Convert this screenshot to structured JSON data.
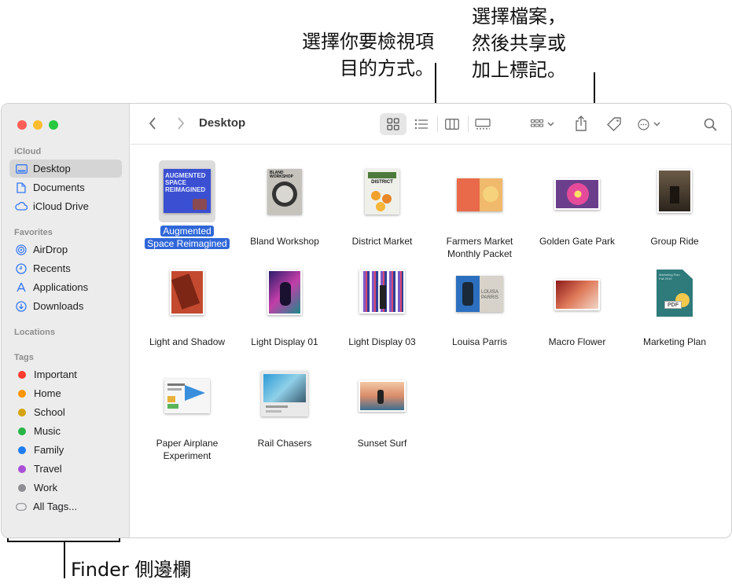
{
  "callouts": {
    "view_line1": "選擇你要檢視項",
    "view_line2": "目的方式。",
    "share_line1": "選擇檔案，",
    "share_line2": "然後共享或",
    "share_line3": "加上標記。",
    "sidebar": "Finder 側邊欄"
  },
  "toolbar": {
    "title": "Desktop"
  },
  "sidebar": {
    "icloud_header": "iCloud",
    "icloud": [
      {
        "label": "Desktop",
        "icon": "desktop-icon"
      },
      {
        "label": "Documents",
        "icon": "document-icon"
      },
      {
        "label": "iCloud Drive",
        "icon": "cloud-icon"
      }
    ],
    "favorites_header": "Favorites",
    "favorites": [
      {
        "label": "AirDrop",
        "icon": "airdrop-icon"
      },
      {
        "label": "Recents",
        "icon": "clock-icon"
      },
      {
        "label": "Applications",
        "icon": "applications-icon"
      },
      {
        "label": "Downloads",
        "icon": "download-icon"
      }
    ],
    "locations_header": "Locations",
    "tags_header": "Tags",
    "tags": [
      {
        "label": "Important",
        "color": "#ff3b30"
      },
      {
        "label": "Home",
        "color": "#ff9500"
      },
      {
        "label": "School",
        "color": "#d4a20a"
      },
      {
        "label": "Music",
        "color": "#28b446"
      },
      {
        "label": "Family",
        "color": "#1f7cf2"
      },
      {
        "label": "Travel",
        "color": "#a94fd6"
      },
      {
        "label": "Work",
        "color": "#8e8e93"
      }
    ],
    "all_tags": "All Tags..."
  },
  "files": {
    "augmented_l1": "Augmented",
    "augmented_l2": "Space Reimagined",
    "augmented_thumb_text": "AUGMENTED SPACE REIMAGINED",
    "bland": "Bland Workshop",
    "bland_thumb_text": "BLAND WORKSHOP",
    "district": "District Market",
    "district_thumb_text": "DISTRICT",
    "farmers_l1": "Farmers Market",
    "farmers_l2": "Monthly Packet",
    "golden": "Golden Gate Park",
    "group": "Group Ride",
    "light_shadow": "Light and Shadow",
    "light01": "Light Display 01",
    "light03": "Light Display 03",
    "louisa": "Louisa Parris",
    "louisa_thumb_text": "LOUISA PARRIS",
    "macro": "Macro Flower",
    "marketing": "Marketing Plan",
    "marketing_thumb_text": "Marketing Plan Fall 2019",
    "marketing_badge": "PDF",
    "paper_l1": "Paper Airplane",
    "paper_l2": "Experiment",
    "rail": "Rail Chasers",
    "sunset": "Sunset Surf"
  },
  "colors": {
    "selection": "#2f67d8",
    "accent": "#3478f6"
  }
}
